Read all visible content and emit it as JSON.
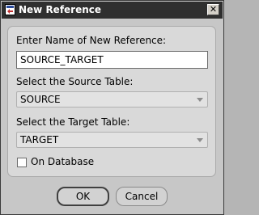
{
  "window": {
    "title": "New Reference",
    "icons": {
      "app": "reference-app-icon",
      "close": "close-icon"
    },
    "close_glyph": "✕"
  },
  "form": {
    "name_label": "Enter Name of New Reference:",
    "name_value": "SOURCE_TARGET",
    "source_label": "Select the Source Table:",
    "source_value": "SOURCE",
    "target_label": "Select the Target Table:",
    "target_value": "TARGET",
    "on_database_label": "On Database",
    "on_database_checked": false
  },
  "buttons": {
    "ok_label": "OK",
    "cancel_label": "Cancel"
  },
  "colors": {
    "titlebar": "#2f2f2f",
    "background": "#c7c7c7",
    "panel": "#d9d9d9"
  }
}
